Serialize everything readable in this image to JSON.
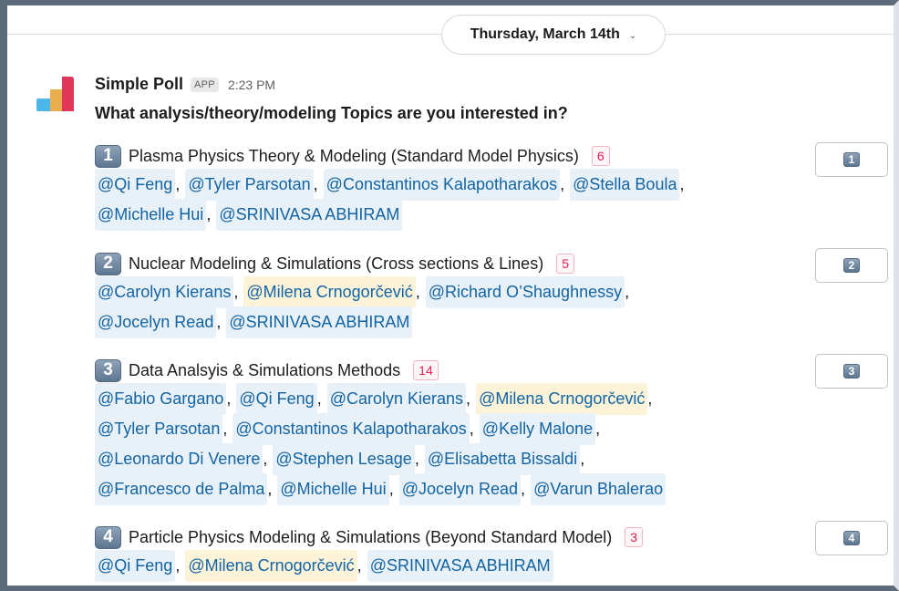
{
  "date_divider": {
    "label": "Thursday, March 14th",
    "chevron_icon": "chevron-down-icon"
  },
  "message": {
    "app_name": "Simple Poll",
    "badge": "APP",
    "time": "2:23 PM",
    "question": "What analysis/theory/modeling Topics are you interested in?"
  },
  "colors": {
    "mention_bg": "#e8f0f8",
    "self_mention_bg": "#fdf3d9",
    "count_red": "#e01e5a",
    "link_blue": "#1264a3"
  },
  "options": [
    {
      "number": "1",
      "title": "Plasma Physics Theory & Modeling (Standard Model Physics)",
      "count": "6",
      "mentions": [
        [
          "@Qi Feng",
          "@Tyler Parsotan",
          "@Constantinos Kalapotharakos",
          "@Stella Boula"
        ],
        [
          "@Michelle Hui",
          "@SRINIVASA ABHIRAM"
        ]
      ]
    },
    {
      "number": "2",
      "title": "Nuclear Modeling & Simulations (Cross sections & Lines)",
      "count": "5",
      "mentions": [
        [
          "@Carolyn Kierans",
          "@Milena Crnogorčević",
          "@Richard O’Shaughnessy"
        ],
        [
          "@Jocelyn Read",
          "@SRINIVASA ABHIRAM"
        ]
      ]
    },
    {
      "number": "3",
      "title": "Data Analsyis & Simulations Methods",
      "count": "14",
      "mentions": [
        [
          "@Fabio Gargano",
          "@Qi Feng",
          "@Carolyn Kierans",
          "@Milena Crnogorčević"
        ],
        [
          "@Tyler Parsotan",
          "@Constantinos Kalapotharakos",
          "@Kelly Malone"
        ],
        [
          "@Leonardo Di Venere",
          "@Stephen Lesage",
          "@Elisabetta Bissaldi"
        ],
        [
          "@Francesco de Palma",
          "@Michelle Hui",
          "@Jocelyn Read",
          "@Varun Bhalerao"
        ]
      ]
    },
    {
      "number": "4",
      "title": "Particle Physics Modeling & Simulations (Beyond Standard Model)",
      "count": "3",
      "mentions": [
        [
          "@Qi Feng",
          "@Milena Crnogorčević",
          "@SRINIVASA ABHIRAM"
        ]
      ]
    }
  ],
  "self_mention": "@Milena Crnogorčević"
}
